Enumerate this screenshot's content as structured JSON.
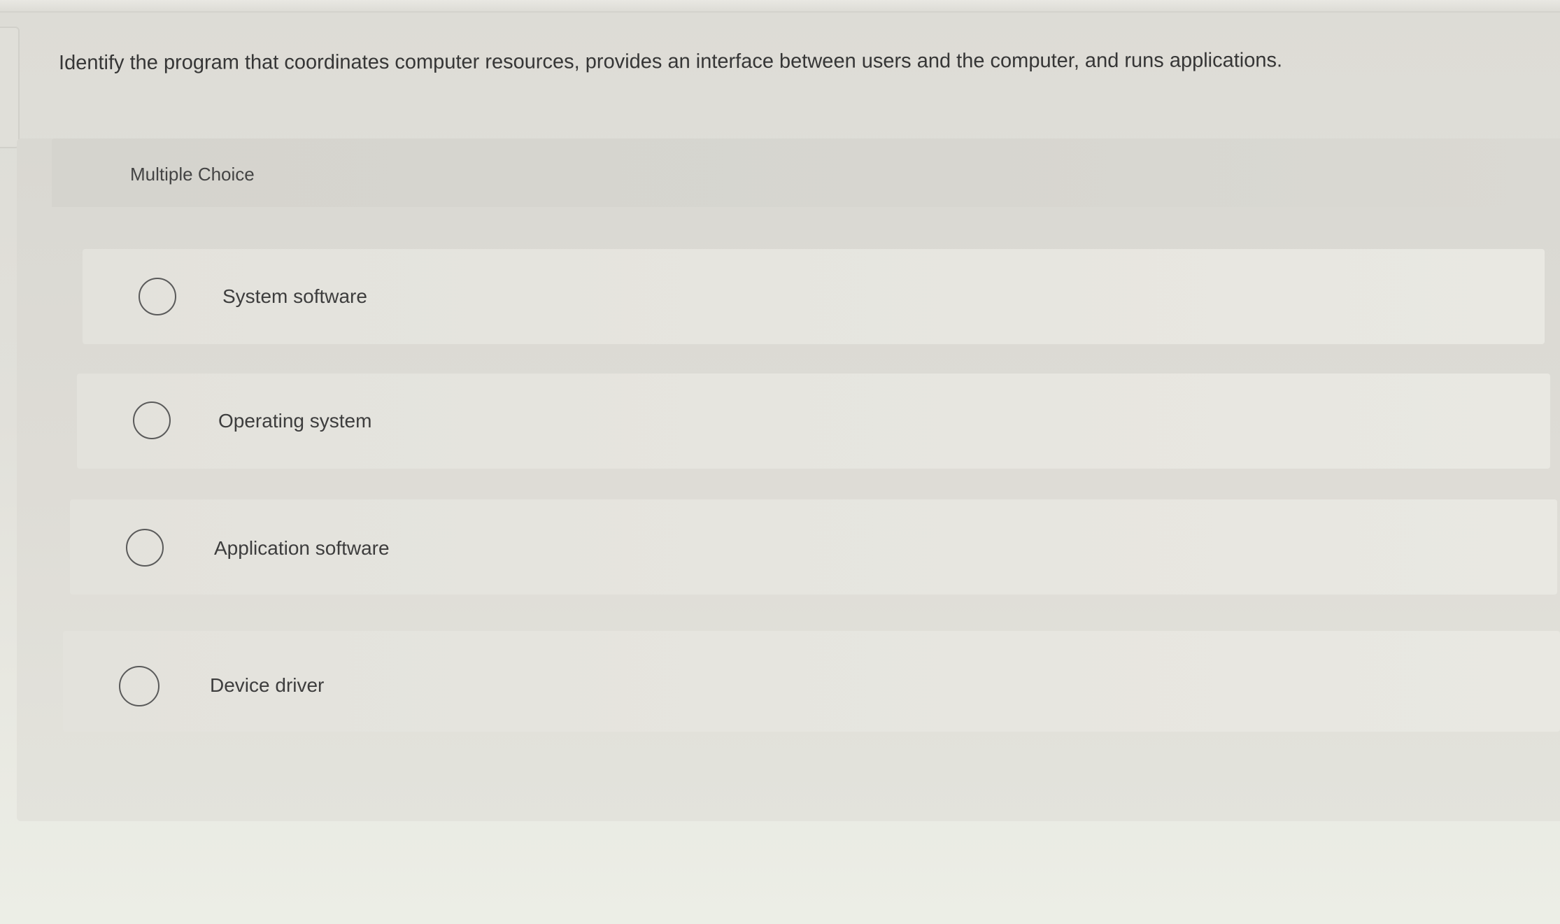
{
  "question": {
    "text": "Identify the program that coordinates computer resources, provides an interface between users and the computer, and runs applications."
  },
  "card": {
    "type_label": "Multiple Choice"
  },
  "options": [
    {
      "label": "System software",
      "selected": false
    },
    {
      "label": "Operating system",
      "selected": false
    },
    {
      "label": "Application software",
      "selected": false
    },
    {
      "label": "Device driver",
      "selected": false
    }
  ]
}
